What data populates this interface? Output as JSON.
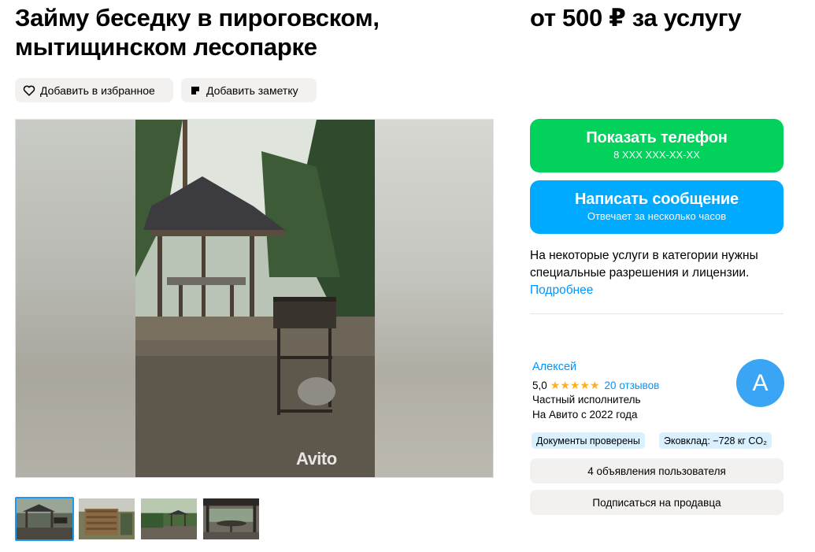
{
  "listing": {
    "title": "Займу беседку в пироговском, мытищинском лесопарке",
    "price": "от 500 ₽ за услугу"
  },
  "actions": {
    "favorite_label": "Добавить в избранное",
    "note_label": "Добавить заметку"
  },
  "gallery": {
    "watermark": "Avito",
    "thumbnails": [
      "гриль у беседки",
      "деревянная конструкция",
      "беседка в лесу",
      "стол под навесом"
    ],
    "active_thumbnail": 1
  },
  "contact": {
    "phone_button": "Показать телефон",
    "phone_masked": "8 XXX XXX-XX-XX",
    "message_button": "Написать сообщение",
    "message_sub": "Отвечает за несколько часов"
  },
  "notice": {
    "text": "На некоторые услуги в категории нужны специальные разрешения и лицензии.",
    "link": "Подробнее"
  },
  "seller": {
    "name": "Алексей",
    "rating": "5,0",
    "stars": "★★★★★",
    "reviews": "20 отзывов",
    "type": "Частный исполнитель",
    "since": "На Авито с 2022 года",
    "avatar_letter": "А",
    "badges": [
      "Документы проверены",
      "Эковклад: −728 кг CO₂"
    ],
    "listings_button": "4 объявления пользователя",
    "subscribe_button": "Подписаться на продавца"
  },
  "colors": {
    "phone_button": "#02d15c",
    "message_button": "#00aaff",
    "link": "#0094ff",
    "avatar": "#3ba5f5",
    "stars": "#ffb021"
  },
  "icons": [
    "heart-icon",
    "note-icon"
  ]
}
